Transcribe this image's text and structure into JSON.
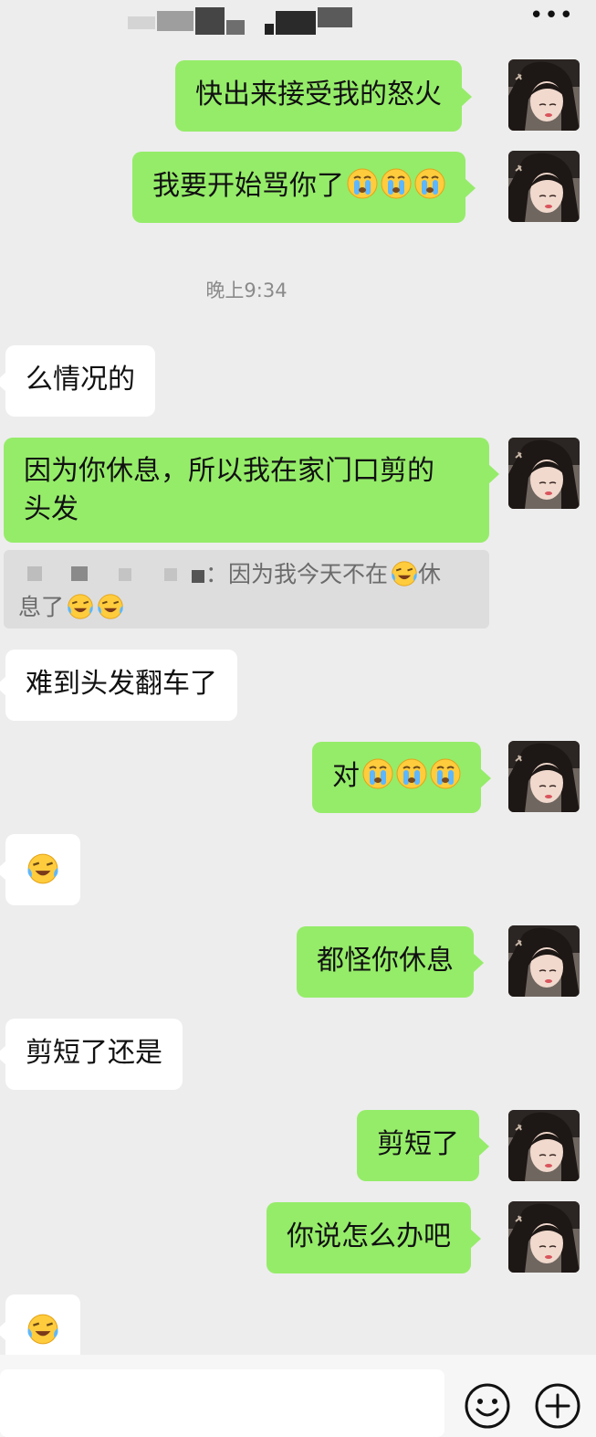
{
  "header": {
    "title_blurred": true,
    "more_icon": "more-dots-icon",
    "more_glyph": "•••"
  },
  "timestamp": "晚上9:34",
  "messages": [
    {
      "side": "me",
      "text": "快出来接受我的怒火",
      "emojis": []
    },
    {
      "side": "me",
      "text": "我要开始骂你了",
      "emojis": [
        "crying-face",
        "crying-face",
        "crying-face"
      ]
    },
    {
      "side": "other",
      "text": "么情况的",
      "emojis": []
    },
    {
      "side": "me",
      "line1": "因为你休息，所以我在家门口剪的",
      "line2": "头发",
      "emojis": []
    },
    {
      "side": "other",
      "text": "难到头发翻车了",
      "emojis": []
    },
    {
      "side": "me",
      "text": "对",
      "emojis": [
        "crying-face",
        "crying-face",
        "crying-face"
      ]
    },
    {
      "side": "other",
      "text": "",
      "emojis": [
        "laughing-tears-face"
      ]
    },
    {
      "side": "me",
      "text": "都怪你休息",
      "emojis": []
    },
    {
      "side": "other",
      "text": "剪短了还是",
      "emojis": []
    },
    {
      "side": "me",
      "text": "剪短了",
      "emojis": []
    },
    {
      "side": "me",
      "text": "你说怎么办吧",
      "emojis": []
    },
    {
      "side": "other",
      "text": "",
      "emojis": [
        "laughing-tears-face"
      ]
    }
  ],
  "quote": {
    "sender_blurred": true,
    "text1": "：因为我今天不在",
    "text2": "休",
    "text3": "息了"
  },
  "colors": {
    "background": "#ededed",
    "bubble_me": "#95ec69",
    "bubble_other": "#ffffff",
    "quote_bg": "#dddddd"
  },
  "input_bar": {
    "emoji_icon": "smiley-icon",
    "plus_icon": "plus-circle-icon"
  }
}
